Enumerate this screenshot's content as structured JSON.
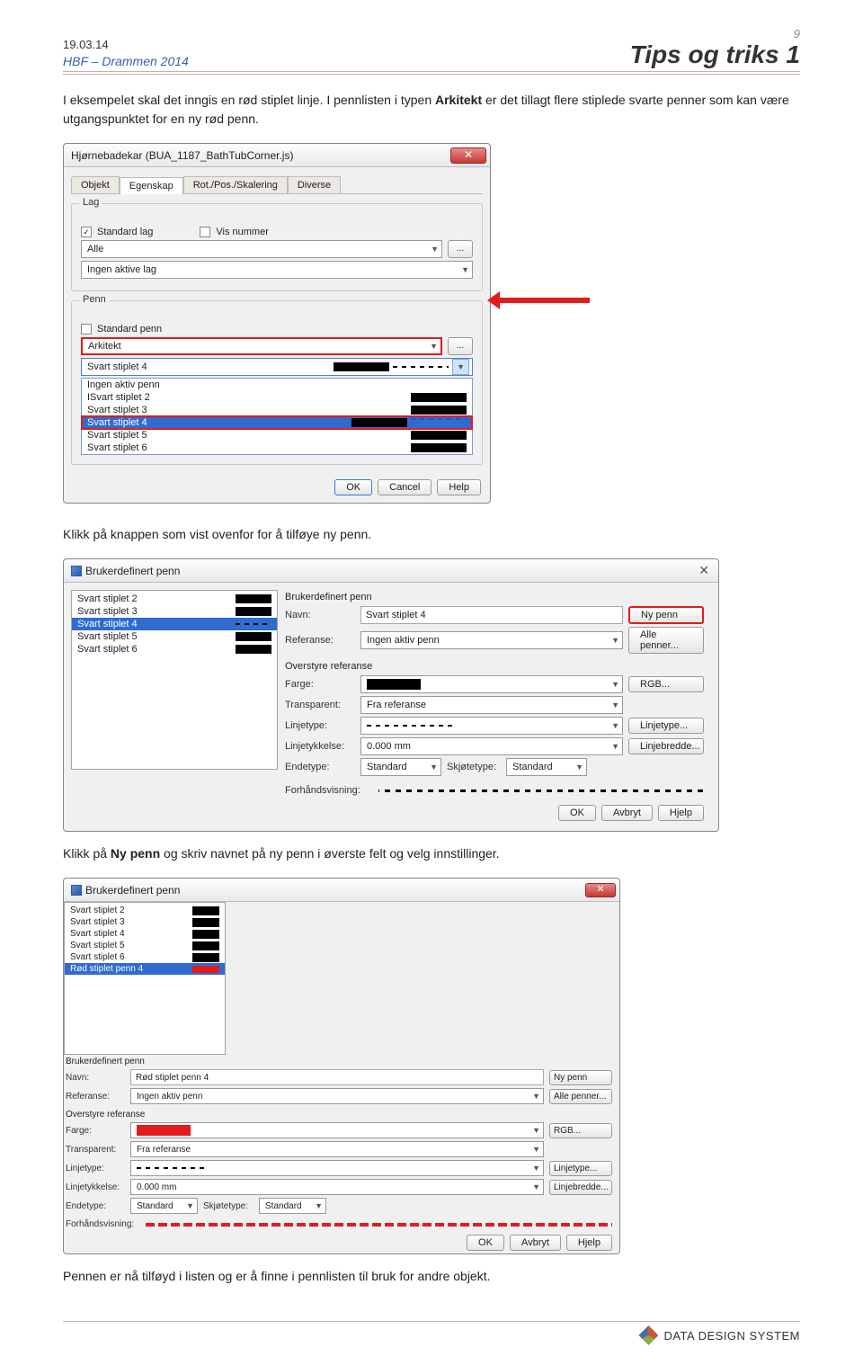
{
  "header": {
    "date": "19.03.14",
    "sub": "HBF – Drammen 2014",
    "page_num": "9",
    "title": "Tips og triks 1"
  },
  "p1": "I eksempelet skal det inngis en rød stiplet linje. I pennlisten i typen ",
  "p1_b": "Arkitekt",
  "p1_rest": " er det tillagt flere stiplede svarte penner som kan være utgangspunktet for en ny rød penn.",
  "p2": "Klikk på knappen som vist ovenfor for å tilføye ny penn.",
  "p3a": "Klikk på ",
  "p3b": "Ny penn",
  "p3c": " og skriv navnet på ny penn i øverste felt og velg innstillinger.",
  "p4": "Pennen er nå tilføyd i listen og er å finne i pennlisten til bruk for andre objekt.",
  "dialog1": {
    "title": "Hjørnebadekar (BUA_1187_BathTubCorner.js)",
    "tabs": [
      "Objekt",
      "Egenskap",
      "Rot./Pos./Skalering",
      "Diverse"
    ],
    "grp_lag": "Lag",
    "standard_lag": "Standard lag",
    "vis_nummer": "Vis nummer",
    "combo_alle": "Alle",
    "combo_ingen": "Ingen aktive lag",
    "grp_penn": "Penn",
    "standard_penn": "Standard penn",
    "arkitekt": "Arkitekt",
    "current": "Svart stiplet 4",
    "list": [
      "Ingen aktiv penn",
      "ISvart stiplet 2",
      "Svart stiplet 3",
      "Svart stiplet 4",
      "Svart stiplet 5",
      "Svart stiplet 6"
    ],
    "btn_ok": "OK",
    "btn_cancel": "Cancel",
    "btn_help": "Help"
  },
  "dialog2": {
    "title": "Brukerdefinert penn",
    "list": [
      "Svart stiplet 2",
      "Svart stiplet 3",
      "Svart stiplet 4",
      "Svart stiplet 5",
      "Svart stiplet 6"
    ],
    "sel": "Svart stiplet 4",
    "grp": "Brukerdefinert penn",
    "lbl_navn": "Navn:",
    "navn": "Svart stiplet 4",
    "btn_ny": "Ny penn",
    "lbl_ref": "Referanse:",
    "ref": "Ingen aktiv penn",
    "btn_alle": "Alle penner...",
    "grp2": "Overstyre referanse",
    "lbl_farge": "Farge:",
    "btn_rgb": "RGB...",
    "lbl_trans": "Transparent:",
    "trans": "Fra referanse",
    "lbl_linjetype": "Linjetype:",
    "btn_linjetype": "Linjetype...",
    "lbl_linjetyk": "Linjetykkelse:",
    "linjetyk": "0.000 mm",
    "btn_bredde": "Linjebredde...",
    "lbl_ende": "Endetype:",
    "ende": "Standard",
    "lbl_skj": "Skjøtetype:",
    "skj": "Standard",
    "lbl_preview": "Forhåndsvisning:",
    "btn_ok": "OK",
    "btn_avbryt": "Avbryt",
    "btn_hjelp": "Hjelp"
  },
  "dialog3": {
    "title": "Brukerdefinert penn",
    "list": [
      "Svart stiplet 2",
      "Svart stiplet 3",
      "Svart stiplet 4",
      "Svart stiplet 5",
      "Svart stiplet 6",
      "Rød stiplet penn 4"
    ],
    "sel": "Rød stiplet penn 4",
    "navn": "Rød stiplet penn 4",
    "ref": "Ingen aktiv penn",
    "trans": "Fra referanse",
    "linjetyk": "0.000 mm",
    "ende": "Standard",
    "skj": "Standard",
    "btn_ok": "OK",
    "btn_avbryt": "Avbryt",
    "btn_hjelp": "Hjelp"
  },
  "footer": {
    "company": "DATA DESIGN SYSTEM"
  }
}
